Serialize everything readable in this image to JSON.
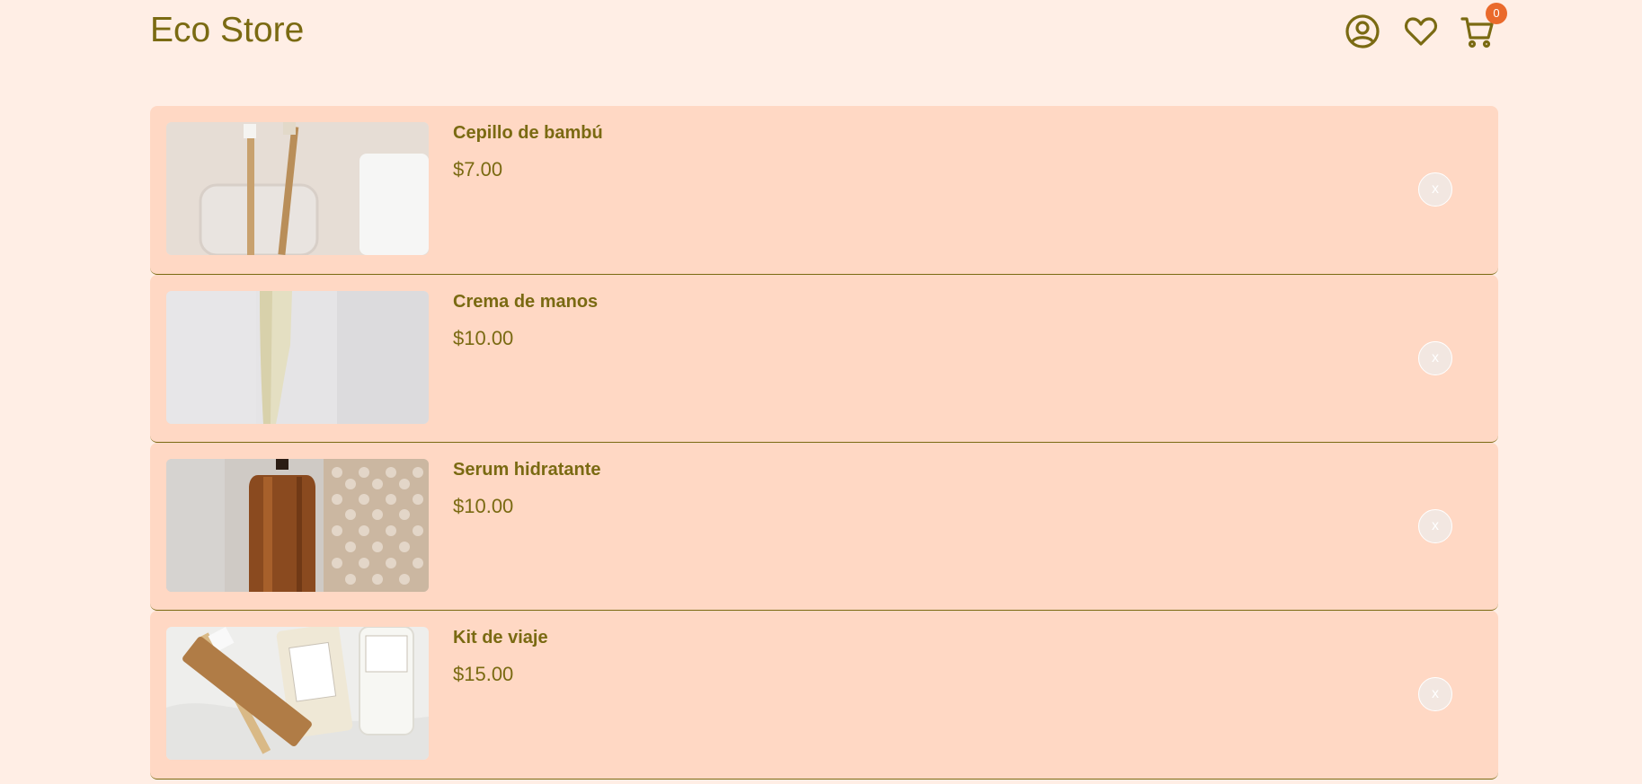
{
  "header": {
    "brand": "Eco Store",
    "icons": [
      "user-account-icon",
      "heart-icon",
      "cart-icon"
    ],
    "cart_count": "0"
  },
  "colors": {
    "background": "#ffeee5",
    "card": "#ffd8c4",
    "accent_text": "#7a6a12",
    "badge": "#ea6a2c"
  },
  "cart": {
    "items": [
      {
        "name": "Cepillo de bambú",
        "price": "$7.00",
        "image": "bamboo-toothbrush-photo",
        "remove_label": "x"
      },
      {
        "name": "Crema de manos",
        "price": "$10.00",
        "image": "hand-cream-tube-photo",
        "remove_label": "x"
      },
      {
        "name": "Serum hidratante",
        "price": "$10.00",
        "image": "serum-bottle-photo",
        "remove_label": "x"
      },
      {
        "name": "Kit de viaje",
        "price": "$15.00",
        "image": "travel-kit-photo",
        "remove_label": "x"
      }
    ]
  }
}
